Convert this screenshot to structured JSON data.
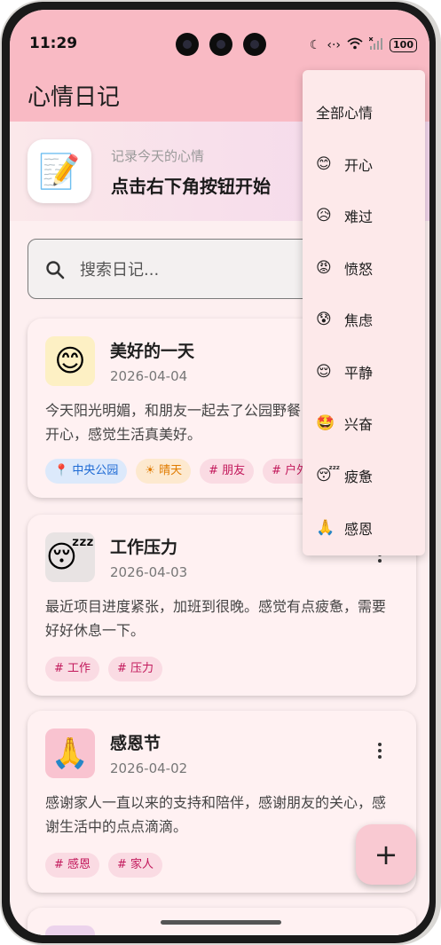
{
  "status_bar": {
    "time": "11:29",
    "battery": "100"
  },
  "app": {
    "title": "心情日记"
  },
  "banner": {
    "icon": "📝",
    "subtitle": "记录今天的心情",
    "title": "点击右下角按钮开始"
  },
  "search": {
    "placeholder": "搜索日记..."
  },
  "diaries": [
    {
      "emoji": "😊",
      "title": "美好的一天",
      "date": "2026-04-04",
      "text": "今天阳光明媚，和朋友一起去了公园野餐，心情变得很开心，感觉生活真美好。",
      "tags": {
        "location": "📍 中央公园",
        "weather": "☀ 晴天",
        "t1": "# 朋友",
        "t2": "# 户外"
      }
    },
    {
      "emoji": "😴",
      "title": "工作压力",
      "date": "2026-04-03",
      "text": "最近项目进度紧张，加班到很晚。感觉有点疲惫，需要好好休息一下。",
      "tags": {
        "t1": "# 工作",
        "t2": "# 压力"
      }
    },
    {
      "emoji": "🙏",
      "title": "感恩节",
      "date": "2026-04-02",
      "text": "感谢家人一直以来的支持和陪伴，感谢朋友的关心，感谢生活中的点点滴滴。",
      "tags": {
        "t1": "# 感恩",
        "t2": "# 家人"
      }
    }
  ],
  "fab": {
    "label": "+"
  },
  "mood_menu": {
    "items": [
      {
        "icon": "",
        "label": "全部心情"
      },
      {
        "icon": "😊",
        "label": "开心"
      },
      {
        "icon": "😥",
        "label": "难过"
      },
      {
        "icon": "😡",
        "label": "愤怒"
      },
      {
        "icon": "😰",
        "label": "焦虑"
      },
      {
        "icon": "😌",
        "label": "平静"
      },
      {
        "icon": "🤩",
        "label": "兴奋"
      },
      {
        "icon": "😴",
        "label": "疲惫"
      },
      {
        "icon": "🙏",
        "label": "感恩"
      }
    ]
  }
}
